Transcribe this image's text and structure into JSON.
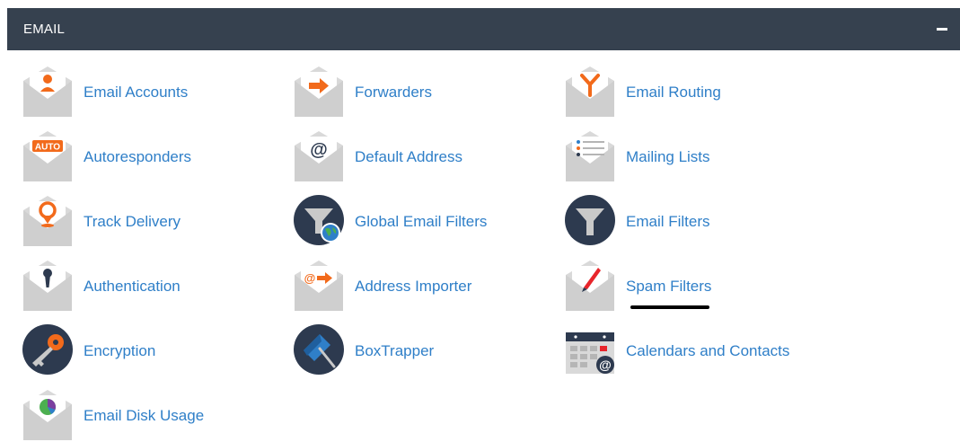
{
  "section": {
    "title": "EMAIL",
    "collapse_icon": "minus-icon"
  },
  "items": [
    {
      "label": "Email Accounts",
      "icon": "email-accounts-icon"
    },
    {
      "label": "Forwarders",
      "icon": "forwarders-icon"
    },
    {
      "label": "Email Routing",
      "icon": "email-routing-icon"
    },
    {
      "label": "Autoresponders",
      "icon": "autoresponders-icon",
      "icon_text": "AUTO"
    },
    {
      "label": "Default Address",
      "icon": "default-address-icon",
      "icon_text": "@"
    },
    {
      "label": "Mailing Lists",
      "icon": "mailing-lists-icon"
    },
    {
      "label": "Track Delivery",
      "icon": "track-delivery-icon"
    },
    {
      "label": "Global Email Filters",
      "icon": "global-email-filters-icon"
    },
    {
      "label": "Email Filters",
      "icon": "email-filters-icon"
    },
    {
      "label": "Authentication",
      "icon": "authentication-icon"
    },
    {
      "label": "Address Importer",
      "icon": "address-importer-icon",
      "icon_text": "@"
    },
    {
      "label": "Spam Filters",
      "icon": "spam-filters-icon"
    },
    {
      "label": "Encryption",
      "icon": "encryption-icon"
    },
    {
      "label": "BoxTrapper",
      "icon": "boxtrapper-icon"
    },
    {
      "label": "Calendars and Contacts",
      "icon": "calendars-contacts-icon",
      "icon_text": "@"
    },
    {
      "label": "Email Disk Usage",
      "icon": "email-disk-usage-icon"
    }
  ],
  "colors": {
    "header_bg": "#36414f",
    "link": "#2f7fc8",
    "accent_orange": "#f26a1b",
    "envelope": "#d9d9d9",
    "dark_circle": "#2d3a4f"
  }
}
